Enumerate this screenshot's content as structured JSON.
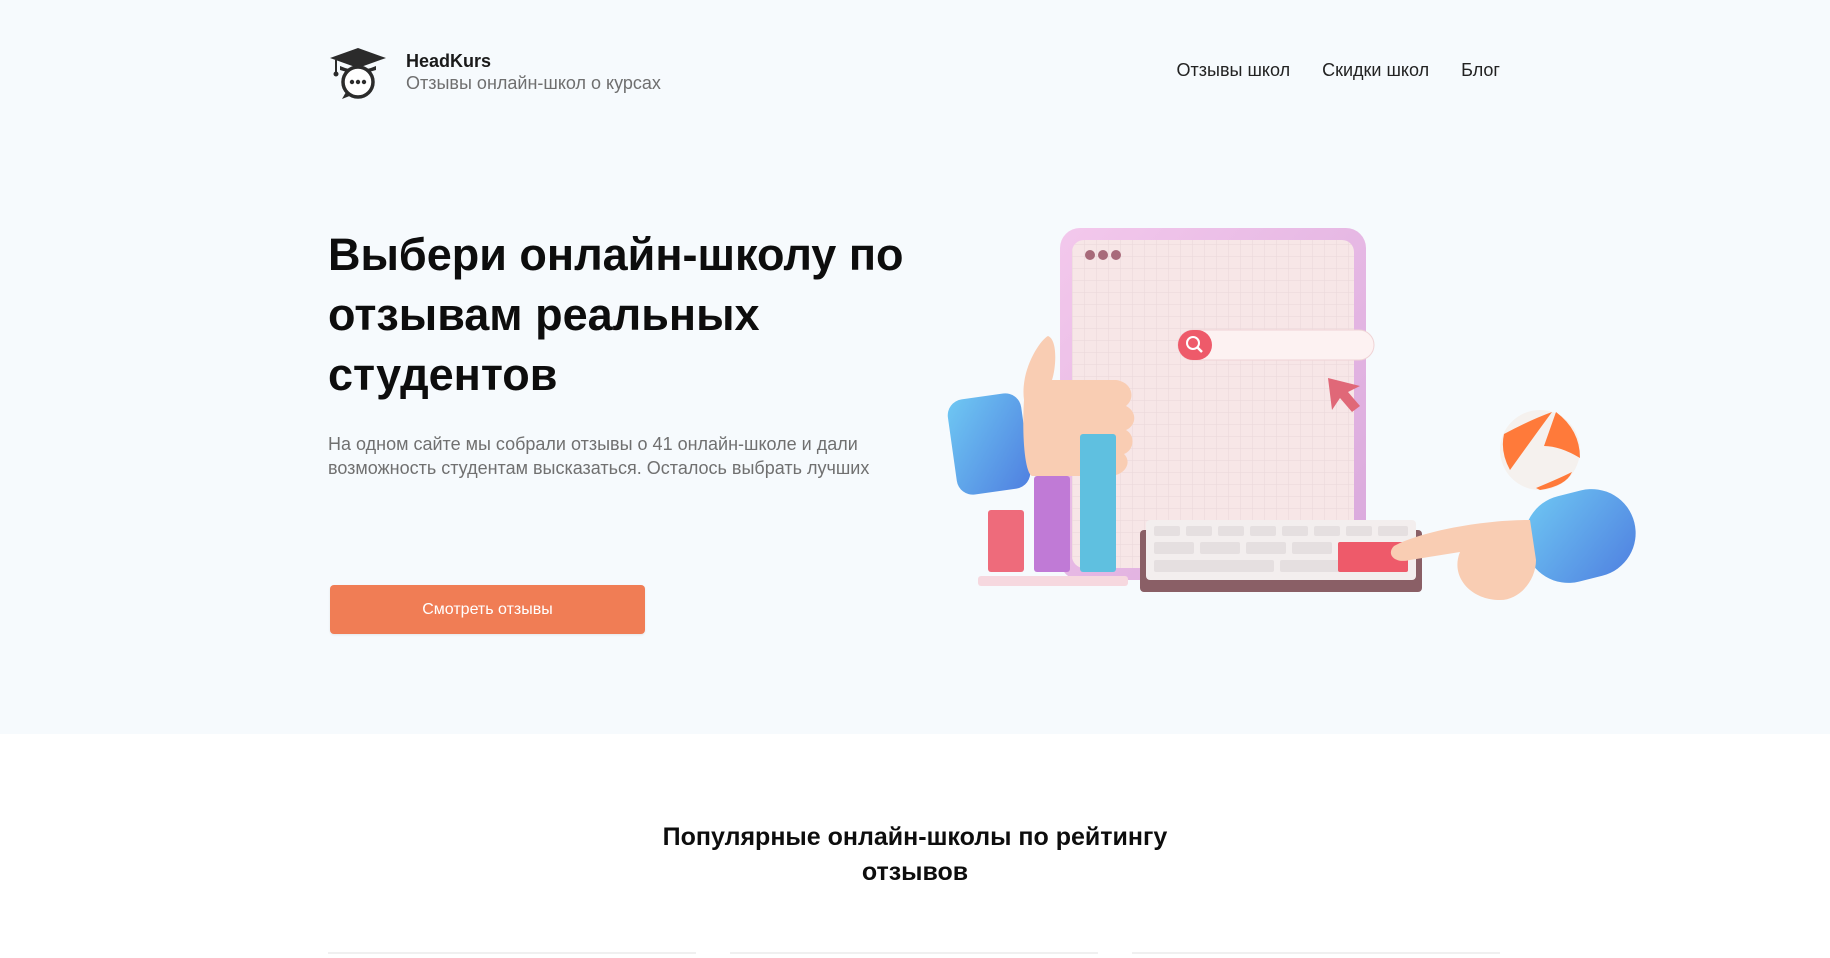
{
  "header": {
    "brand_name": "HeadKurs",
    "brand_tagline": "Отзывы онлайн-школ о курсах",
    "nav": [
      {
        "label": "Отзывы школ"
      },
      {
        "label": "Скидки школ"
      },
      {
        "label": "Блог"
      }
    ]
  },
  "hero": {
    "title": "Выбери онлайн-школу по отзывам реальных студентов",
    "description": "На одном сайте мы собрали отзывы о 41 онлайн-школе и дали возможность студентам высказаться. Осталось выбрать лучших",
    "cta_label": "Смотреть отзывы"
  },
  "popular": {
    "title": "Популярные онлайн-школы по рейтингу отзывов"
  },
  "colors": {
    "accent": "#f07d55",
    "hero_bg": "#f6fafd",
    "text": "#111111",
    "muted": "#707070"
  },
  "icons": {
    "logo": "graduation-cap-chat-icon",
    "search": "search-icon",
    "cursor": "cursor-arrow-icon"
  }
}
